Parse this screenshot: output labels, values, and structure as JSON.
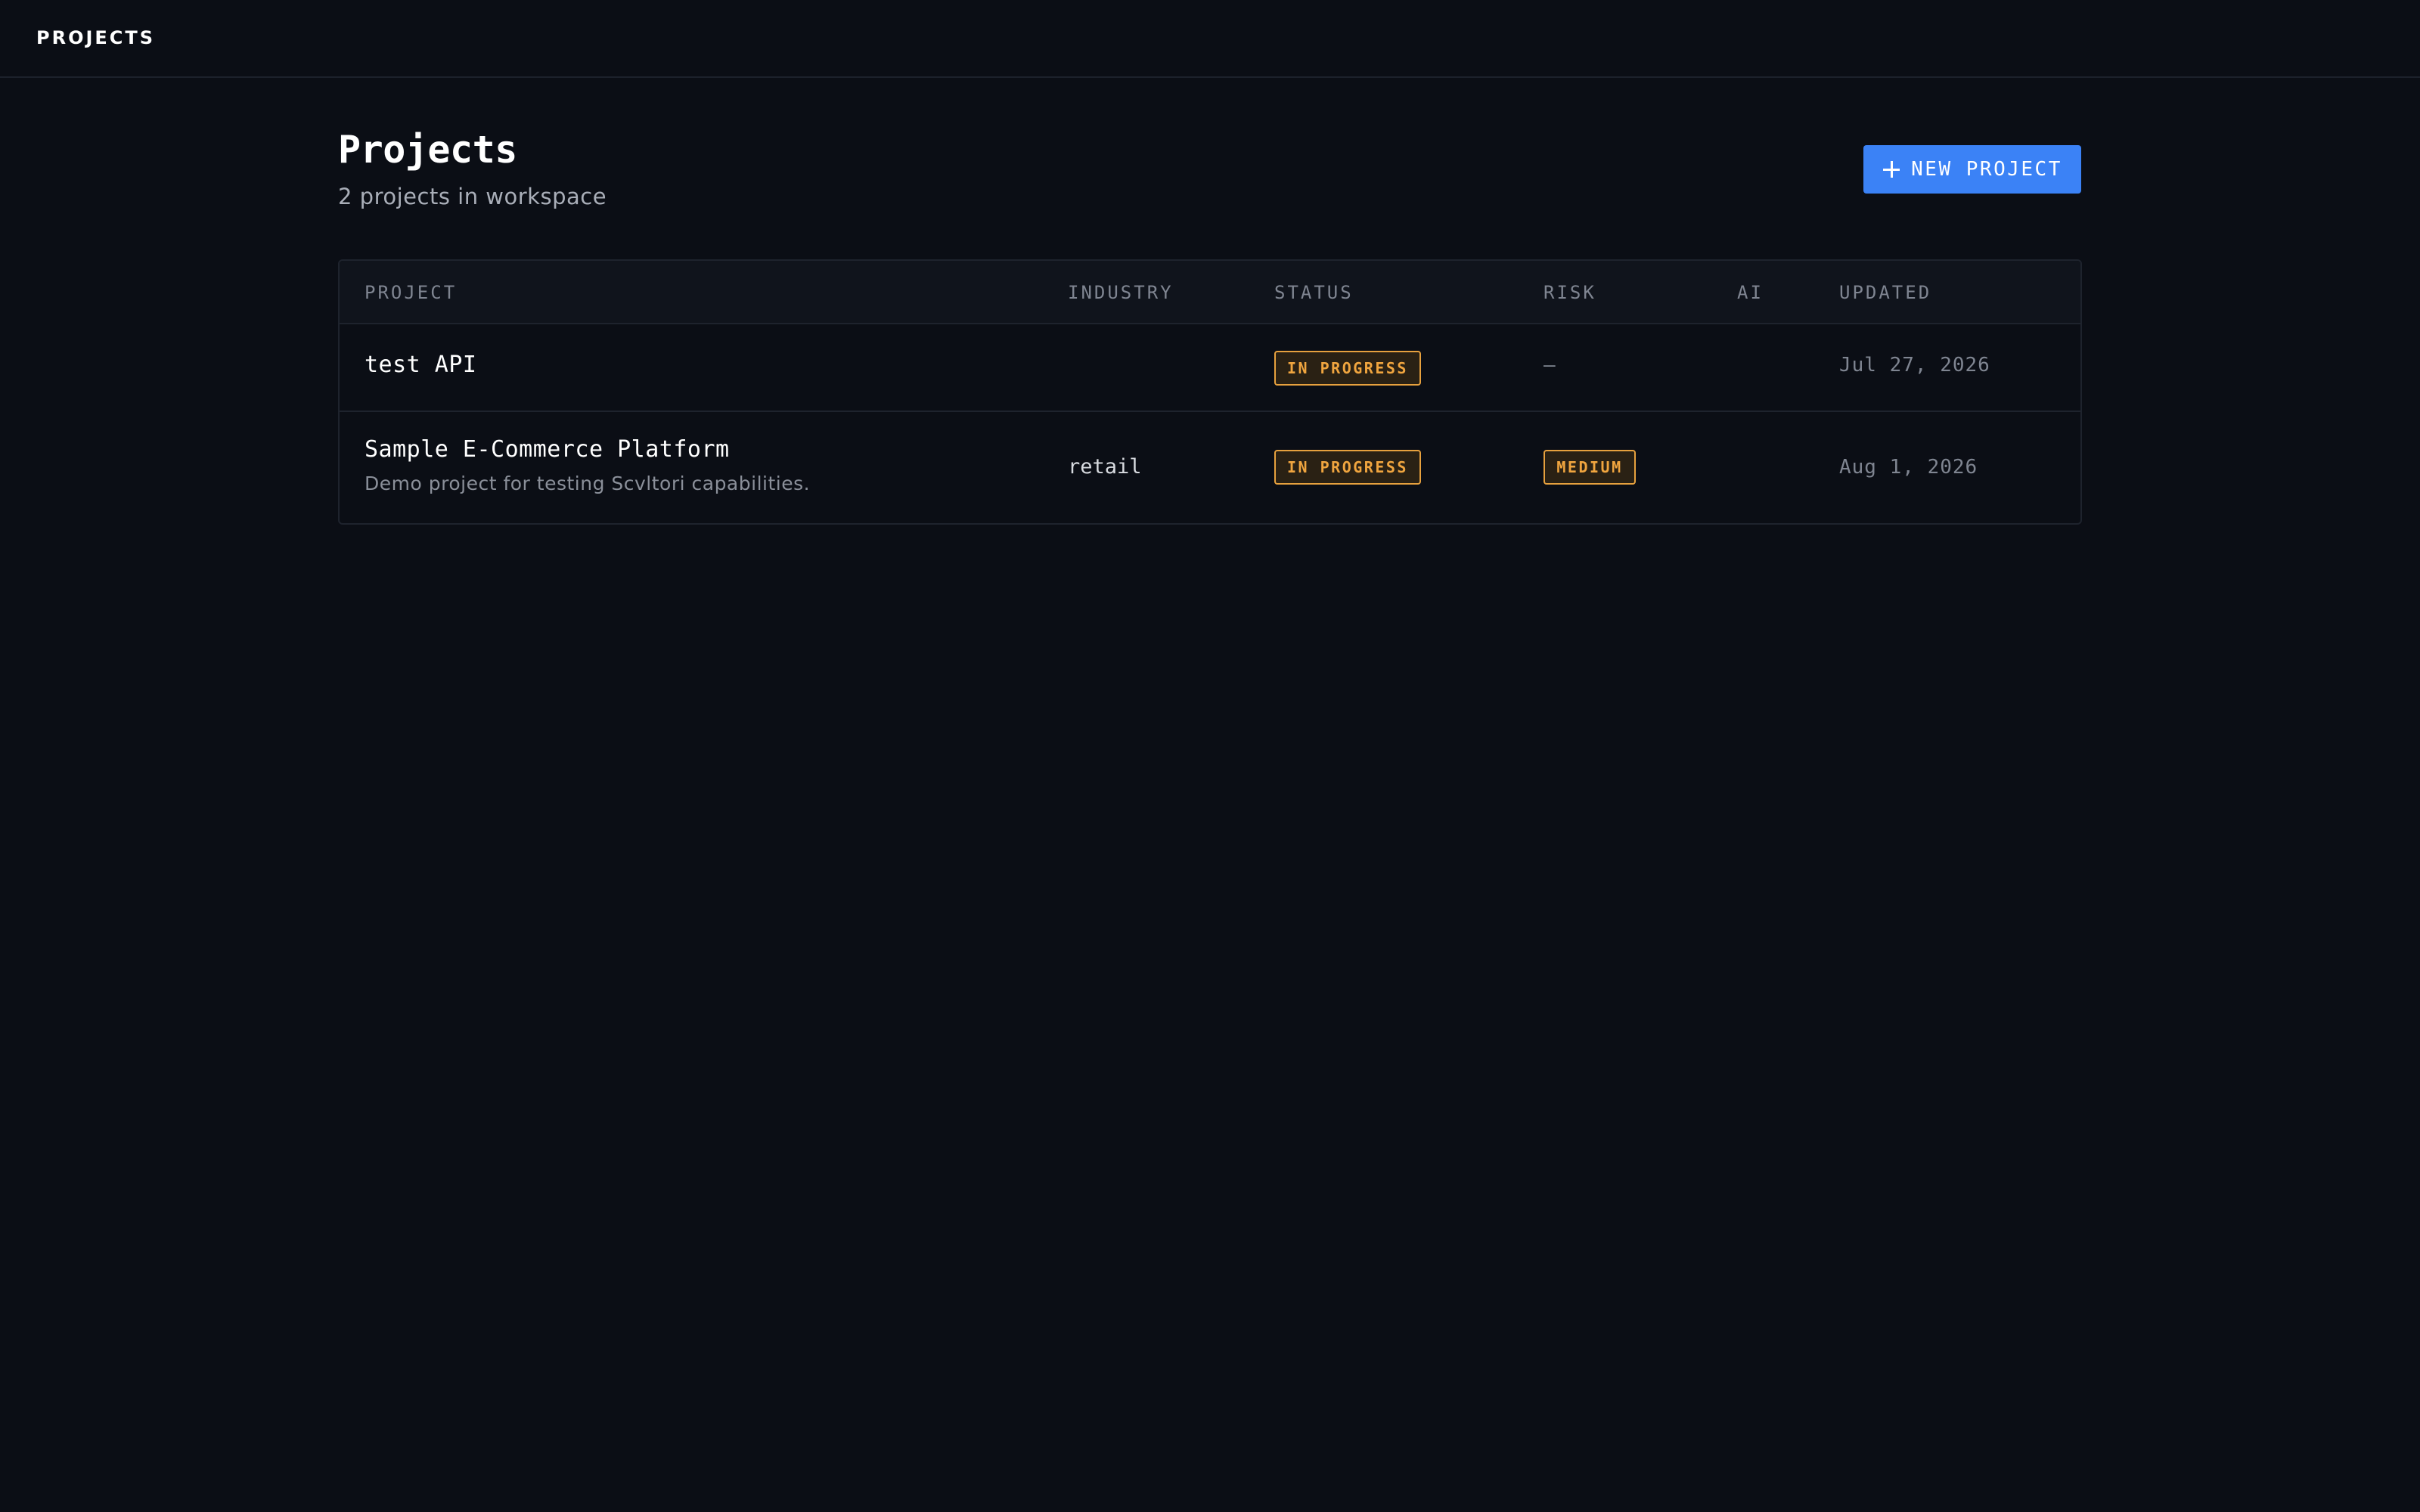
{
  "topbar": {
    "title": "PROJECTS"
  },
  "header": {
    "title": "Projects",
    "subtitle": "2 projects in workspace",
    "new_project_label": "NEW PROJECT"
  },
  "table": {
    "columns": [
      "PROJECT",
      "INDUSTRY",
      "STATUS",
      "RISK",
      "AI",
      "UPDATED"
    ],
    "rows": [
      {
        "name": "test API",
        "description": "",
        "industry": "",
        "status": "IN PROGRESS",
        "risk": "—",
        "ai": "",
        "updated": "Jul 27, 2026"
      },
      {
        "name": "Sample E-Commerce Platform",
        "description": "Demo project for testing Scvltori capabilities.",
        "industry": "retail",
        "status": "IN PROGRESS",
        "risk": "MEDIUM",
        "ai": "",
        "updated": "Aug 1, 2026"
      }
    ]
  },
  "colors": {
    "background": "#0b0e15",
    "accent": "#3b82f6",
    "badge_warning": "#f0a53f"
  },
  "icons": {
    "new_project": "plus-icon"
  }
}
